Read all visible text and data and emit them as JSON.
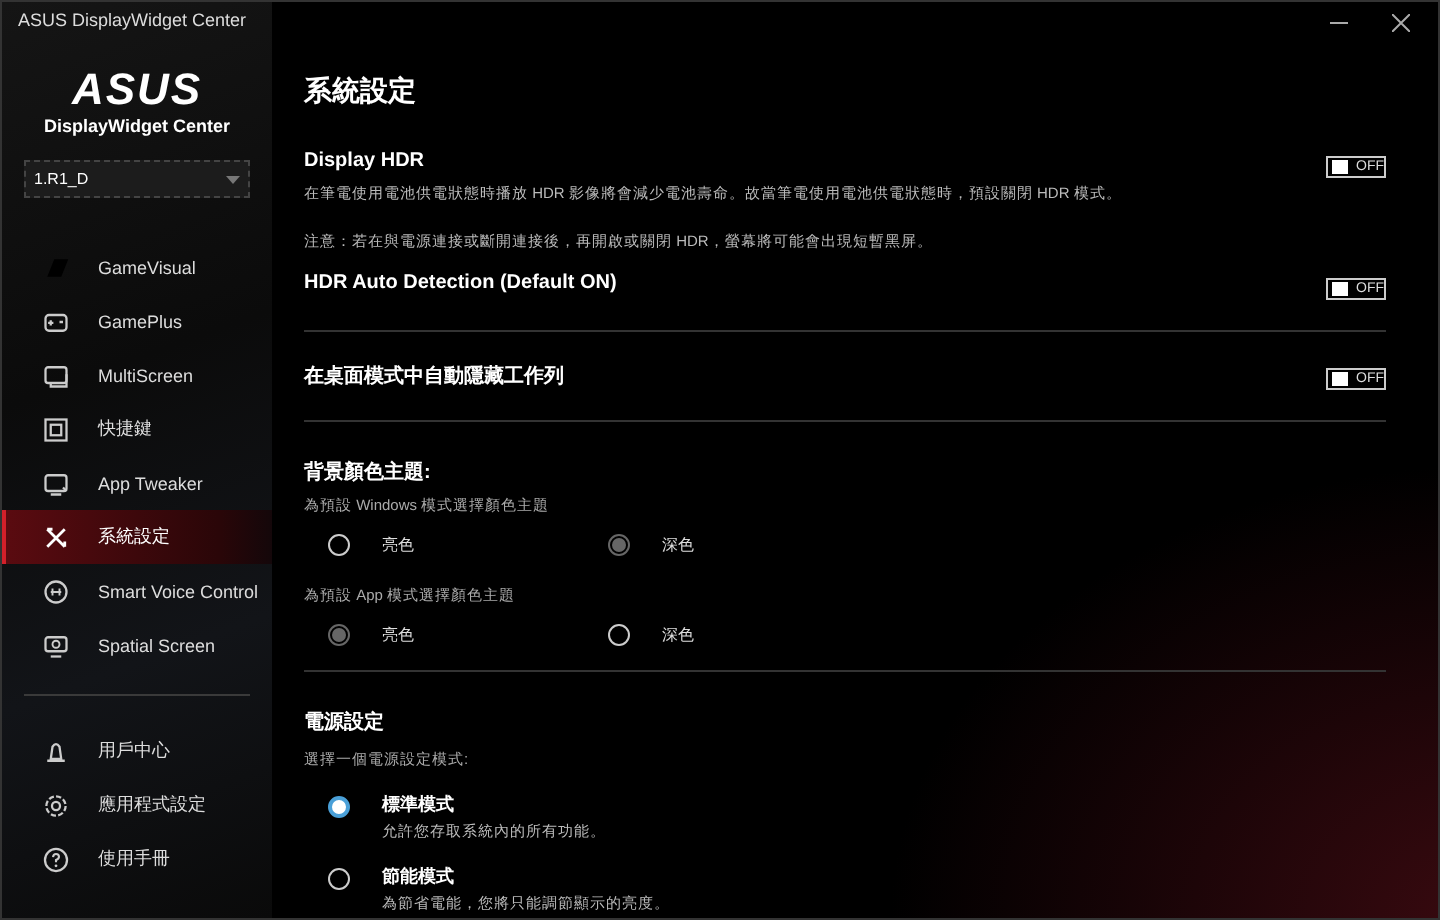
{
  "window": {
    "title": "ASUS DisplayWidget Center"
  },
  "sidebar": {
    "logo": "ASUS",
    "app_name": "DisplayWidget Center",
    "display_select": {
      "value": "1.R1_D"
    },
    "items": [
      {
        "label": "GameVisual",
        "selected": false
      },
      {
        "label": "GamePlus",
        "selected": false
      },
      {
        "label": "MultiScreen",
        "selected": false
      },
      {
        "label": "快捷鍵",
        "selected": false
      },
      {
        "label": "App Tweaker",
        "selected": false
      },
      {
        "label": "系統設定",
        "selected": true
      },
      {
        "label": "Smart Voice Control",
        "selected": false
      },
      {
        "label": "Spatial Screen",
        "selected": false
      }
    ],
    "bottom_items": [
      {
        "label": "用戶中心"
      },
      {
        "label": "應用程式設定"
      },
      {
        "label": "使用手冊"
      }
    ]
  },
  "page": {
    "title": "系統設定",
    "hdr": {
      "title": "Display HDR",
      "toggle": {
        "label": "OFF",
        "on": false
      },
      "description": "在筆電使用電池供電狀態時播放 HDR 影像將會減少電池壽命。故當筆電使用電池供電狀態時，預設關閉 HDR 模式。",
      "note": "注意：若在與電源連接或斷開連接後，再開啟或關閉 HDR，螢幕將可能會出現短暫黑屏。"
    },
    "hdr_auto": {
      "title": "HDR Auto Detection (Default ON)",
      "toggle": {
        "label": "OFF",
        "on": false
      }
    },
    "taskbar": {
      "title": "在桌面模式中自動隱藏工作列",
      "toggle": {
        "label": "OFF",
        "on": false
      }
    },
    "theme": {
      "title": "背景顏色主題:",
      "groups": [
        {
          "label": "為預設 Windows 模式選擇顏色主題",
          "options": [
            {
              "label": "亮色",
              "selected": false
            },
            {
              "label": "深色",
              "selected": true
            }
          ]
        },
        {
          "label": "為預設 App 模式選擇顏色主題",
          "options": [
            {
              "label": "亮色",
              "selected": true
            },
            {
              "label": "深色",
              "selected": false
            }
          ]
        }
      ]
    },
    "power": {
      "title": "電源設定",
      "subtitle": "選擇一個電源設定模式:",
      "options": [
        {
          "label": "標準模式",
          "description": "允許您存取系統內的所有功能。",
          "selected": true
        },
        {
          "label": "節能模式",
          "description": "為節省電能，您將只能調節顯示的亮度。",
          "selected": false
        }
      ]
    }
  }
}
